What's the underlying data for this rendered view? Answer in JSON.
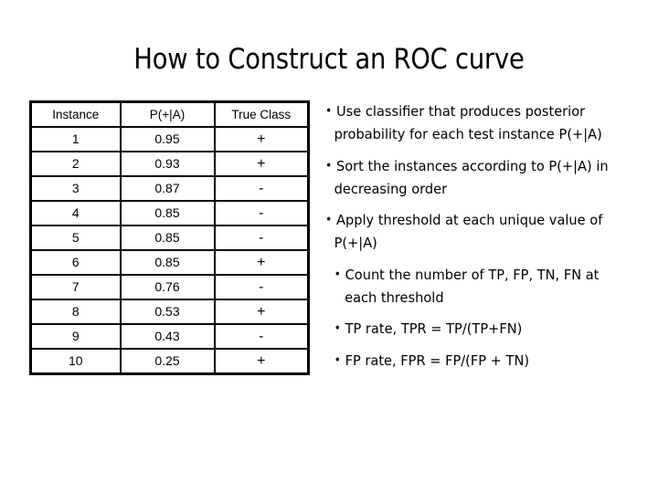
{
  "slide": {
    "title": "How to Construct an ROC curve"
  },
  "table": {
    "columns": [
      "Instance",
      "P(+|A)",
      "True Class"
    ],
    "rows": [
      {
        "instance": "1",
        "prob": "0.95",
        "class": "+"
      },
      {
        "instance": "2",
        "prob": "0.93",
        "class": "+"
      },
      {
        "instance": "3",
        "prob": "0.87",
        "class": "-"
      },
      {
        "instance": "4",
        "prob": "0.85",
        "class": "-"
      },
      {
        "instance": "5",
        "prob": "0.85",
        "class": "-"
      },
      {
        "instance": "6",
        "prob": "0.85",
        "class": "+"
      },
      {
        "instance": "7",
        "prob": "0.76",
        "class": "-"
      },
      {
        "instance": "8",
        "prob": "0.53",
        "class": "+"
      },
      {
        "instance": "9",
        "prob": "0.43",
        "class": "-"
      },
      {
        "instance": "10",
        "prob": "0.25",
        "class": "+"
      }
    ]
  },
  "bullets": [
    {
      "marker": "•",
      "text": "Use classifier that produces posterior probability for each test instance P(+|A)",
      "hanging": false
    },
    {
      "marker": "•",
      "text": "Sort the instances according to P(+|A) in decreasing order",
      "hanging": false
    },
    {
      "marker": "•",
      "text": "Apply threshold at each unique value of P(+|A)",
      "hanging": false
    },
    {
      "marker": "•",
      "text": "Count the number of TP, FP, TN, FN at each threshold",
      "hanging": true
    },
    {
      "marker": "•",
      "text": "TP rate, TPR = TP/(TP+FN)",
      "hanging": true
    },
    {
      "marker": "•",
      "text": "FP rate, FPR = FP/(FP + TN)",
      "hanging": true
    }
  ],
  "colors": {
    "background": "#ffffff",
    "text": "#000000",
    "table_border": "#000000"
  }
}
